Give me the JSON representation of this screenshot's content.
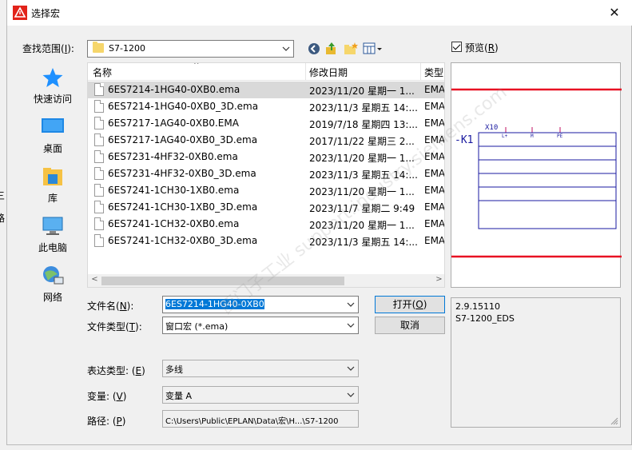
{
  "window": {
    "title": "选择宏",
    "close_glyph": "✕"
  },
  "location": {
    "label": "查找范围(",
    "accel": "I",
    "label_end": "):",
    "value": "S7-1200"
  },
  "places": [
    {
      "label": "快速访问",
      "icon": "quick-access-icon"
    },
    {
      "label": "桌面",
      "icon": "desktop-icon"
    },
    {
      "label": "库",
      "icon": "library-icon"
    },
    {
      "label": "此电脑",
      "icon": "this-pc-icon"
    },
    {
      "label": "网络",
      "icon": "network-icon"
    }
  ],
  "columns": {
    "name": "名称",
    "date": "修改日期",
    "type": "类型"
  },
  "files": [
    {
      "name": "6ES7214-1HG40-0XB0.ema",
      "date": "2023/11/20 星期一 1...",
      "type": "EMA",
      "selected": true
    },
    {
      "name": "6ES7214-1HG40-0XB0_3D.ema",
      "date": "2023/11/3 星期五 14:...",
      "type": "EMA"
    },
    {
      "name": "6ES7217-1AG40-0XB0.EMA",
      "date": "2019/7/18 星期四 13:...",
      "type": "EMA"
    },
    {
      "name": "6ES7217-1AG40-0XB0_3D.ema",
      "date": "2017/11/22 星期三 2...",
      "type": "EMA"
    },
    {
      "name": "6ES7231-4HF32-0XB0.ema",
      "date": "2023/11/20 星期一 1...",
      "type": "EMA"
    },
    {
      "name": "6ES7231-4HF32-0XB0_3D.ema",
      "date": "2023/11/3 星期五 14:...",
      "type": "EMA"
    },
    {
      "name": "6ES7241-1CH30-1XB0.ema",
      "date": "2023/11/20 星期一 1...",
      "type": "EMA"
    },
    {
      "name": "6ES7241-1CH30-1XB0_3D.ema",
      "date": "2023/11/7 星期二 9:49",
      "type": "EMA"
    },
    {
      "name": "6ES7241-1CH32-0XB0.ema",
      "date": "2023/11/20 星期一 1...",
      "type": "EMA"
    },
    {
      "name": "6ES7241-1CH32-0XB0_3D.ema",
      "date": "2023/11/3 星期五 14:...",
      "type": "EMA"
    }
  ],
  "preview": {
    "checkbox_label": "预览(",
    "accel": "R",
    "label_end": ")",
    "checked": true,
    "schematic": {
      "ref": "-K1",
      "part": "X10",
      "pins": [
        "L+",
        "M",
        "PE"
      ]
    }
  },
  "filename": {
    "label": "文件名(",
    "accel": "N",
    "label_end": "):",
    "value": "6ES7214-1HG40-0XB0"
  },
  "filetype": {
    "label": "文件类型(",
    "accel": "T",
    "label_end": "):",
    "value": "窗口宏 (*.ema)"
  },
  "buttons": {
    "open": "打开(",
    "open_accel": "O",
    "open_end": ")",
    "cancel": "取消"
  },
  "info": {
    "version": "2.9.15110",
    "variant": "S7-1200_EDS"
  },
  "representation": {
    "label": "表达类型:",
    "accel": "E",
    "value": "多线"
  },
  "variant": {
    "label": "变量:",
    "accel": "V",
    "value": "变量 A"
  },
  "path": {
    "label": "路径:",
    "accel": "P",
    "value": "C:\\Users\\Public\\EPLAN\\Data\\宏\\H...\\S7-1200"
  },
  "watermark": "西门子工业 support.industry.siemens.com",
  "outside_fragments": [
    "三",
    "路"
  ],
  "colors": {
    "accent": "#0078d7",
    "highlight_box": "#e81123",
    "schematic": "#1a1aa0",
    "pin": "#c01060"
  }
}
